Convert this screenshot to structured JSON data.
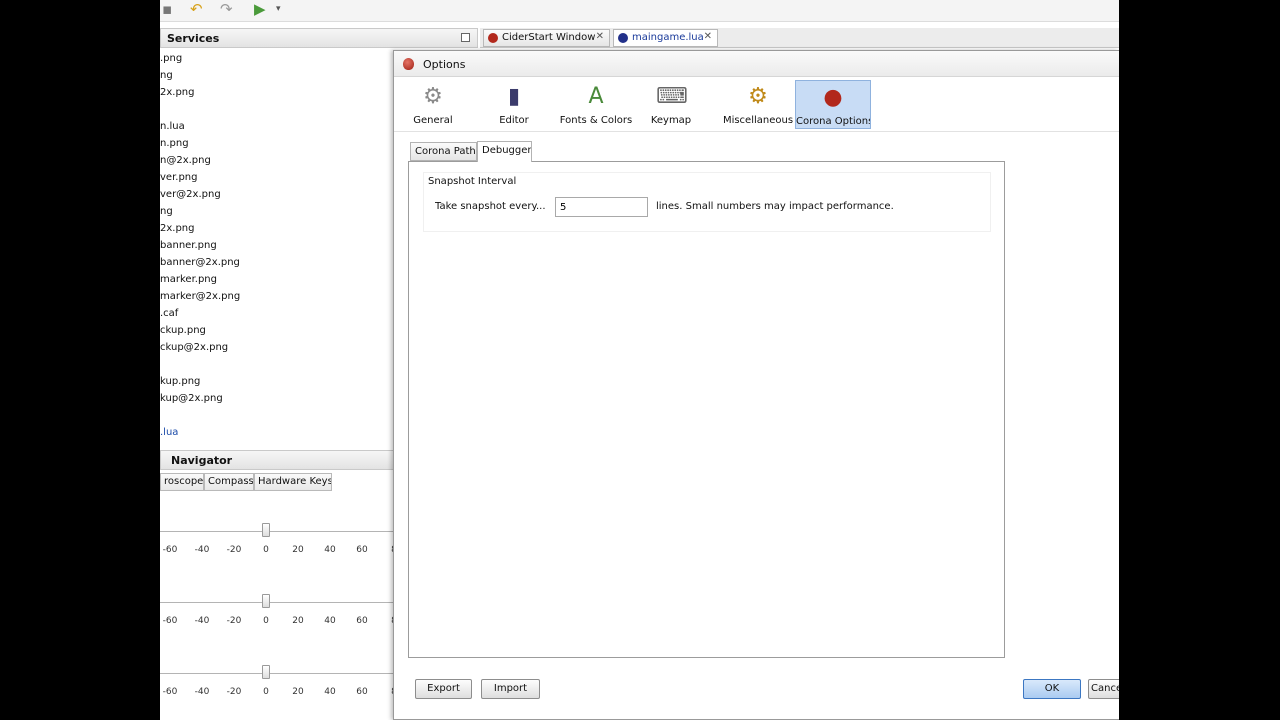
{
  "toolbar": {
    "icons": [
      "save-icon",
      "undo-icon",
      "redo-icon",
      "run-icon"
    ]
  },
  "services": {
    "title": "Services"
  },
  "editor_tabs": [
    {
      "label": "CiderStart Window"
    },
    {
      "label": "maingame.lua"
    }
  ],
  "files": [
    ".png",
    "ng",
    "2x.png",
    "",
    "n.lua",
    "n.png",
    "n@2x.png",
    "ver.png",
    "ver@2x.png",
    "ng",
    "2x.png",
    "banner.png",
    "banner@2x.png",
    "marker.png",
    "marker@2x.png",
    ".caf",
    "ckup.png",
    "ckup@2x.png",
    "",
    "kup.png",
    "kup@2x.png",
    "",
    ".lua"
  ],
  "navigator": {
    "title": "Navigator",
    "tabs": [
      "roscope",
      "Compass",
      "Hardware Keys"
    ],
    "ticks": [
      "-60",
      "-40",
      "-20",
      "0",
      "20",
      "40",
      "60",
      "8"
    ]
  },
  "dialog": {
    "title": "Options",
    "categories": [
      {
        "label": "General",
        "icon": "wrench-gear-icon"
      },
      {
        "label": "Editor",
        "icon": "editor-book-icon"
      },
      {
        "label": "Fonts & Colors",
        "icon": "fonts-colors-icon"
      },
      {
        "label": "Keymap",
        "icon": "keyboard-icon"
      },
      {
        "label": "Miscellaneous",
        "icon": "misc-gear-icon"
      },
      {
        "label": "Corona Options",
        "icon": "corona-icon",
        "selected": true
      }
    ],
    "sub_tabs": [
      {
        "label": "Corona Path",
        "active": false
      },
      {
        "label": "Debugger",
        "active": true
      }
    ],
    "snapshot": {
      "heading": "Snapshot Interval",
      "label": "Take snapshot every...",
      "value": "5",
      "hint": "lines. Small numbers may impact performance."
    },
    "buttons": {
      "export": "Export",
      "import": "Import",
      "ok": "OK",
      "cancel": "Cancel"
    }
  },
  "colors": {
    "selection": "#c8dcf5",
    "link": "#1a4aa8"
  }
}
